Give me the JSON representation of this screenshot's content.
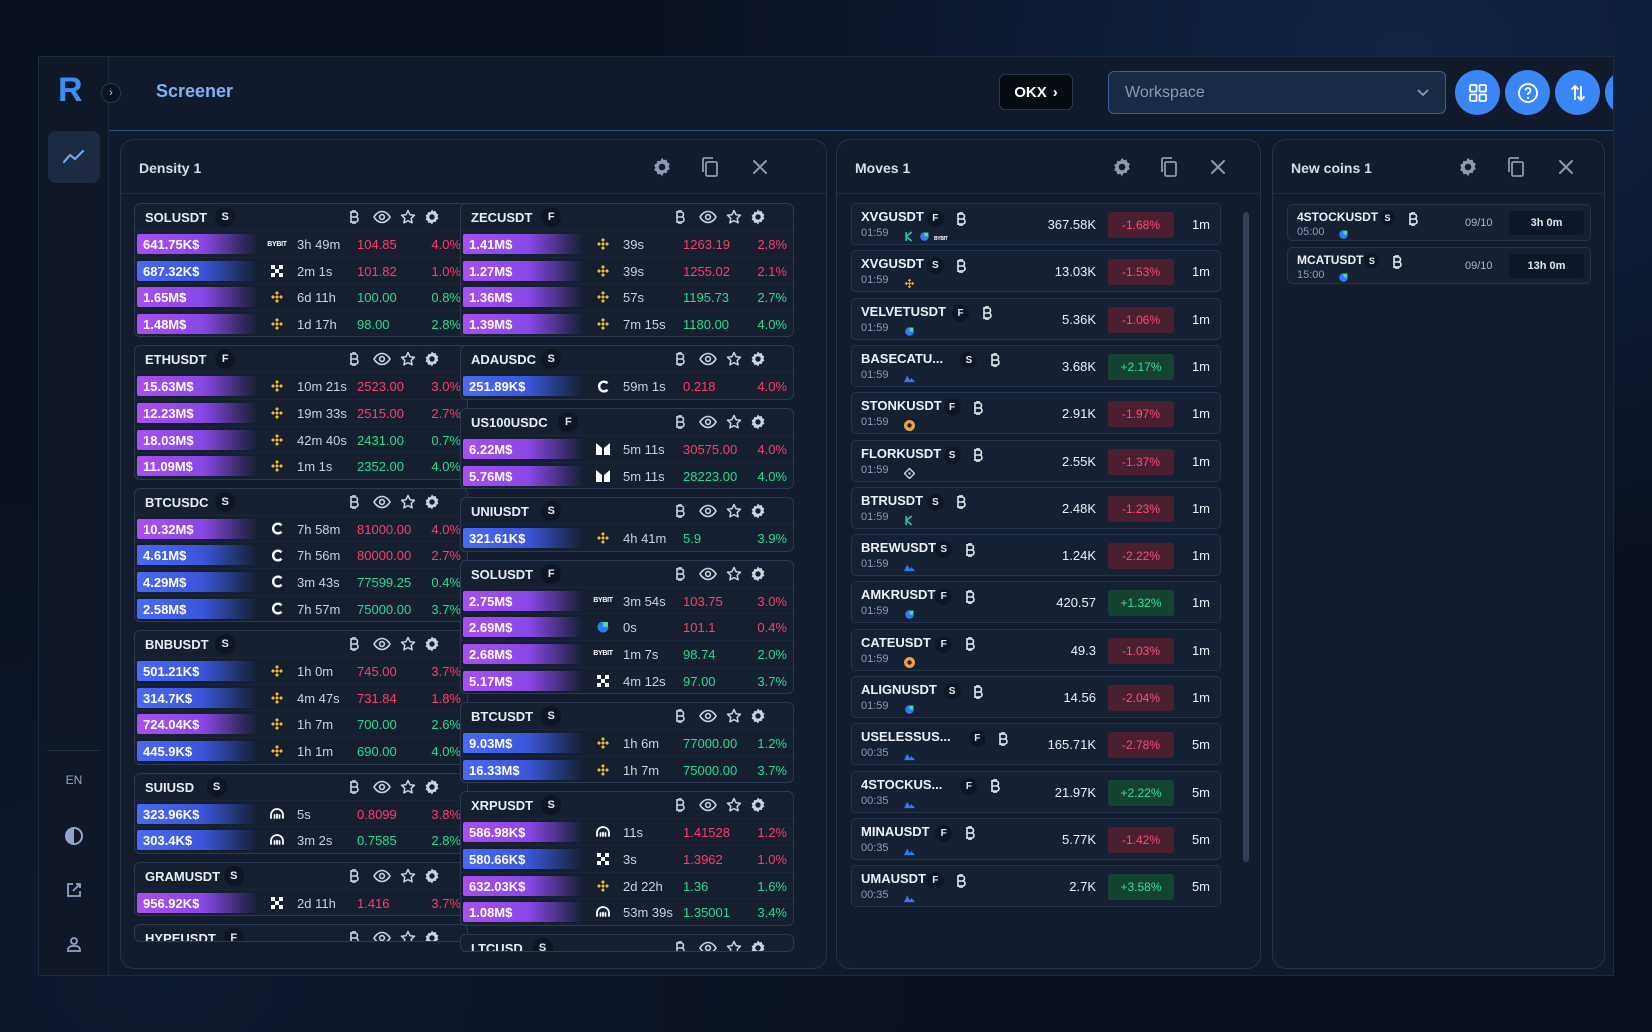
{
  "app": {
    "logo": "R",
    "page_title": "Screener",
    "lang": "EN",
    "exchange": "OKX",
    "workspace_placeholder": "Workspace"
  },
  "density": {
    "title": "Density 1",
    "col1": [
      {
        "symbol": "SOLUSDT",
        "type": "S",
        "rows": [
          {
            "amount": "641.75K$",
            "bar": "p",
            "ex": "bybit",
            "time": "3h 49m",
            "price": "104.85",
            "pct": "4.0%",
            "pc": "red"
          },
          {
            "amount": "687.32K$",
            "bar": "b",
            "ex": "okx",
            "time": "2m 1s",
            "price": "101.82",
            "pct": "1.0%",
            "pc": "red"
          },
          {
            "amount": "1.65M$",
            "bar": "p",
            "ex": "binance",
            "time": "6d 11h",
            "price": "100.00",
            "pct": "0.8%",
            "pc": "grn"
          },
          {
            "amount": "1.48M$",
            "bar": "p",
            "ex": "binance",
            "time": "1d 17h",
            "price": "98.00",
            "pct": "2.8%",
            "pc": "grn"
          }
        ]
      },
      {
        "symbol": "ETHUSDT",
        "type": "F",
        "rows": [
          {
            "amount": "15.63M$",
            "bar": "p",
            "ex": "binance",
            "time": "10m 21s",
            "price": "2523.00",
            "pct": "3.0%",
            "pc": "red"
          },
          {
            "amount": "12.23M$",
            "bar": "p",
            "ex": "binance",
            "time": "19m 33s",
            "price": "2515.00",
            "pct": "2.7%",
            "pc": "red"
          },
          {
            "amount": "18.03M$",
            "bar": "p",
            "ex": "binance",
            "time": "42m 40s",
            "price": "2431.00",
            "pct": "0.7%",
            "pc": "grn"
          },
          {
            "amount": "11.09M$",
            "bar": "p",
            "ex": "binance",
            "time": "1m 1s",
            "price": "2352.00",
            "pct": "4.0%",
            "pc": "grn"
          }
        ]
      },
      {
        "symbol": "BTCUSDC",
        "type": "S",
        "rows": [
          {
            "amount": "10.32M$",
            "bar": "p",
            "ex": "coinbase",
            "time": "7h 58m",
            "price": "81000.00",
            "pct": "4.0%",
            "pc": "red"
          },
          {
            "amount": "4.61M$",
            "bar": "b",
            "ex": "coinbase",
            "time": "7h 56m",
            "price": "80000.00",
            "pct": "2.7%",
            "pc": "red"
          },
          {
            "amount": "4.29M$",
            "bar": "b",
            "ex": "coinbase",
            "time": "3m 43s",
            "price": "77599.25",
            "pct": "0.4%",
            "pc": "grn"
          },
          {
            "amount": "2.58M$",
            "bar": "b",
            "ex": "coinbase",
            "time": "7h 57m",
            "price": "75000.00",
            "pct": "3.7%",
            "pc": "grn"
          }
        ]
      },
      {
        "symbol": "BNBUSDT",
        "type": "S",
        "rows": [
          {
            "amount": "501.21K$",
            "bar": "b",
            "ex": "binance",
            "time": "1h 0m",
            "price": "745.00",
            "pct": "3.7%",
            "pc": "red"
          },
          {
            "amount": "314.7K$",
            "bar": "b",
            "ex": "binance",
            "time": "4m 47s",
            "price": "731.84",
            "pct": "1.8%",
            "pc": "red"
          },
          {
            "amount": "724.04K$",
            "bar": "p",
            "ex": "binance",
            "time": "1h 7m",
            "price": "700.00",
            "pct": "2.6%",
            "pc": "grn"
          },
          {
            "amount": "445.9K$",
            "bar": "b",
            "ex": "binance",
            "time": "1h 1m",
            "price": "690.00",
            "pct": "4.0%",
            "pc": "grn"
          }
        ]
      },
      {
        "symbol": "SUIUSD",
        "type": "S",
        "rows": [
          {
            "amount": "323.96K$",
            "bar": "b",
            "ex": "kraken",
            "time": "5s",
            "price": "0.8099",
            "pct": "3.8%",
            "pc": "red"
          },
          {
            "amount": "303.4K$",
            "bar": "b",
            "ex": "kraken",
            "time": "3m 2s",
            "price": "0.7585",
            "pct": "2.8%",
            "pc": "grn"
          }
        ]
      },
      {
        "symbol": "GRAMUSDT",
        "type": "S",
        "rows": [
          {
            "amount": "956.92K$",
            "bar": "p",
            "ex": "okx",
            "time": "2d 11h",
            "price": "1.416",
            "pct": "3.7%",
            "pc": "red"
          }
        ]
      },
      {
        "symbol": "HYPEUSDT",
        "type": "F",
        "rows": []
      }
    ],
    "col2": [
      {
        "symbol": "ZECUSDT",
        "type": "F",
        "rows": [
          {
            "amount": "1.41M$",
            "bar": "p",
            "ex": "binance",
            "time": "39s",
            "price": "1263.19",
            "pct": "2.8%",
            "pc": "red"
          },
          {
            "amount": "1.27M$",
            "bar": "p",
            "ex": "binance",
            "time": "39s",
            "price": "1255.02",
            "pct": "2.1%",
            "pc": "red"
          },
          {
            "amount": "1.36M$",
            "bar": "p",
            "ex": "binance",
            "time": "57s",
            "price": "1195.73",
            "pct": "2.7%",
            "pc": "grn"
          },
          {
            "amount": "1.39M$",
            "bar": "p",
            "ex": "binance",
            "time": "7m 15s",
            "price": "1180.00",
            "pct": "4.0%",
            "pc": "grn"
          }
        ]
      },
      {
        "symbol": "ADAUSDC",
        "type": "S",
        "rows": [
          {
            "amount": "251.89K$",
            "bar": "b",
            "ex": "coinbase",
            "time": "59m 1s",
            "price": "0.218",
            "pct": "4.0%",
            "pc": "red"
          }
        ]
      },
      {
        "symbol": "US100USDC",
        "type": "F",
        "rows": [
          {
            "amount": "6.22M$",
            "bar": "p",
            "ex": "hyperliquid",
            "time": "5m 11s",
            "price": "30575.00",
            "pct": "4.0%",
            "pc": "red"
          },
          {
            "amount": "5.76M$",
            "bar": "p",
            "ex": "hyperliquid",
            "time": "5m 11s",
            "price": "28223.00",
            "pct": "4.0%",
            "pc": "grn"
          }
        ]
      },
      {
        "symbol": "UNIUSDT",
        "type": "S",
        "rows": [
          {
            "amount": "321.61K$",
            "bar": "b",
            "ex": "binance",
            "time": "4h 41m",
            "price": "5.9",
            "pct": "3.9%",
            "pc": "grn"
          }
        ]
      },
      {
        "symbol": "SOLUSDT",
        "type": "F",
        "rows": [
          {
            "amount": "2.75M$",
            "bar": "p",
            "ex": "bybit",
            "time": "3m 54s",
            "price": "103.75",
            "pct": "3.0%",
            "pc": "red"
          },
          {
            "amount": "2.69M$",
            "bar": "p",
            "ex": "gate",
            "time": "0s",
            "price": "101.1",
            "pct": "0.4%",
            "pc": "red"
          },
          {
            "amount": "2.68M$",
            "bar": "p",
            "ex": "bybit",
            "time": "1m 7s",
            "price": "98.74",
            "pct": "2.0%",
            "pc": "grn"
          },
          {
            "amount": "5.17M$",
            "bar": "p",
            "ex": "okx",
            "time": "4m 12s",
            "price": "97.00",
            "pct": "3.7%",
            "pc": "grn"
          }
        ]
      },
      {
        "symbol": "BTCUSDT",
        "type": "S",
        "rows": [
          {
            "amount": "9.03M$",
            "bar": "b",
            "ex": "binance",
            "time": "1h 6m",
            "price": "77000.00",
            "pct": "1.2%",
            "pc": "grn"
          },
          {
            "amount": "16.33M$",
            "bar": "b",
            "ex": "binance",
            "time": "1h 7m",
            "price": "75000.00",
            "pct": "3.7%",
            "pc": "grn"
          }
        ]
      },
      {
        "symbol": "XRPUSDT",
        "type": "S",
        "rows": [
          {
            "amount": "586.98K$",
            "bar": "p",
            "ex": "kraken",
            "time": "11s",
            "price": "1.41528",
            "pct": "1.2%",
            "pc": "red"
          },
          {
            "amount": "580.66K$",
            "bar": "b",
            "ex": "okx",
            "time": "3s",
            "price": "1.3962",
            "pct": "1.0%",
            "pc": "red"
          },
          {
            "amount": "632.03K$",
            "bar": "p",
            "ex": "binance",
            "time": "2d 22h",
            "price": "1.36",
            "pct": "1.6%",
            "pc": "grn"
          },
          {
            "amount": "1.08M$",
            "bar": "p",
            "ex": "kraken",
            "time": "53m 39s",
            "price": "1.35001",
            "pct": "3.4%",
            "pc": "grn"
          }
        ]
      },
      {
        "symbol": "LTCUSD",
        "type": "S",
        "rows": []
      }
    ]
  },
  "moves": {
    "title": "Moves 1",
    "rows": [
      {
        "symbol": "XVGUSDT",
        "type": "F",
        "time": "01:59",
        "volume": "367.58K",
        "change": "-1.68%",
        "dir": "neg",
        "tf": "1m",
        "ex": [
          "kucoin",
          "gate",
          "bybit"
        ]
      },
      {
        "symbol": "XVGUSDT",
        "type": "S",
        "time": "01:59",
        "volume": "13.03K",
        "change": "-1.53%",
        "dir": "neg",
        "tf": "1m",
        "ex": [
          "binance"
        ]
      },
      {
        "symbol": "VELVETUSDT",
        "type": "F",
        "time": "01:59",
        "volume": "5.36K",
        "change": "-1.06%",
        "dir": "neg",
        "tf": "1m",
        "ex": [
          "gate"
        ]
      },
      {
        "symbol": "BASECATU...",
        "type": "S",
        "time": "01:59",
        "volume": "3.68K",
        "change": "+2.17%",
        "dir": "pos",
        "tf": "1m",
        "ex": [
          "mexc"
        ]
      },
      {
        "symbol": "STONKUSDT",
        "type": "F",
        "time": "01:59",
        "volume": "2.91K",
        "change": "-1.97%",
        "dir": "neg",
        "tf": "1m",
        "ex": [
          "bingx"
        ]
      },
      {
        "symbol": "FLORKUSDT",
        "type": "S",
        "time": "01:59",
        "volume": "2.55K",
        "change": "-1.37%",
        "dir": "neg",
        "tf": "1m",
        "ex": [
          "bitget"
        ]
      },
      {
        "symbol": "BTRUSDT",
        "type": "S",
        "time": "01:59",
        "volume": "2.48K",
        "change": "-1.23%",
        "dir": "neg",
        "tf": "1m",
        "ex": [
          "kucoin"
        ]
      },
      {
        "symbol": "BREWUSDT",
        "type": "S",
        "time": "01:59",
        "volume": "1.24K",
        "change": "-2.22%",
        "dir": "neg",
        "tf": "1m",
        "ex": [
          "mexc"
        ]
      },
      {
        "symbol": "AMKRUSDT",
        "type": "F",
        "time": "01:59",
        "volume": "420.57",
        "change": "+1.32%",
        "dir": "pos",
        "tf": "1m",
        "ex": [
          "gate"
        ]
      },
      {
        "symbol": "CATEUSDT",
        "type": "F",
        "time": "01:59",
        "volume": "49.3",
        "change": "-1.03%",
        "dir": "neg",
        "tf": "1m",
        "ex": [
          "bingx"
        ]
      },
      {
        "symbol": "ALIGNUSDT",
        "type": "S",
        "time": "01:59",
        "volume": "14.56",
        "change": "-2.04%",
        "dir": "neg",
        "tf": "1m",
        "ex": [
          "gate"
        ]
      },
      {
        "symbol": "USELESSUS...",
        "type": "F",
        "time": "00:35",
        "volume": "165.71K",
        "change": "-2.78%",
        "dir": "neg",
        "tf": "5m",
        "ex": [
          "mexc"
        ]
      },
      {
        "symbol": "4STOCKUS...",
        "type": "F",
        "time": "00:35",
        "volume": "21.97K",
        "change": "+2.22%",
        "dir": "pos",
        "tf": "5m",
        "ex": [
          "mexc"
        ]
      },
      {
        "symbol": "MINAUSDT",
        "type": "F",
        "time": "00:35",
        "volume": "5.77K",
        "change": "-1.42%",
        "dir": "neg",
        "tf": "5m",
        "ex": [
          "mexc"
        ]
      },
      {
        "symbol": "UMAUSDT",
        "type": "F",
        "time": "00:35",
        "volume": "2.7K",
        "change": "+3.58%",
        "dir": "pos",
        "tf": "5m",
        "ex": [
          "mexc"
        ]
      }
    ]
  },
  "new_coins": {
    "title": "New coins 1",
    "rows": [
      {
        "symbol": "4STOCKUSDT",
        "type": "S",
        "time": "05:00",
        "date": "09/10",
        "age": "3h 0m"
      },
      {
        "symbol": "MCATUSDT",
        "type": "S",
        "time": "15:00",
        "date": "09/10",
        "age": "13h 0m"
      }
    ]
  }
}
